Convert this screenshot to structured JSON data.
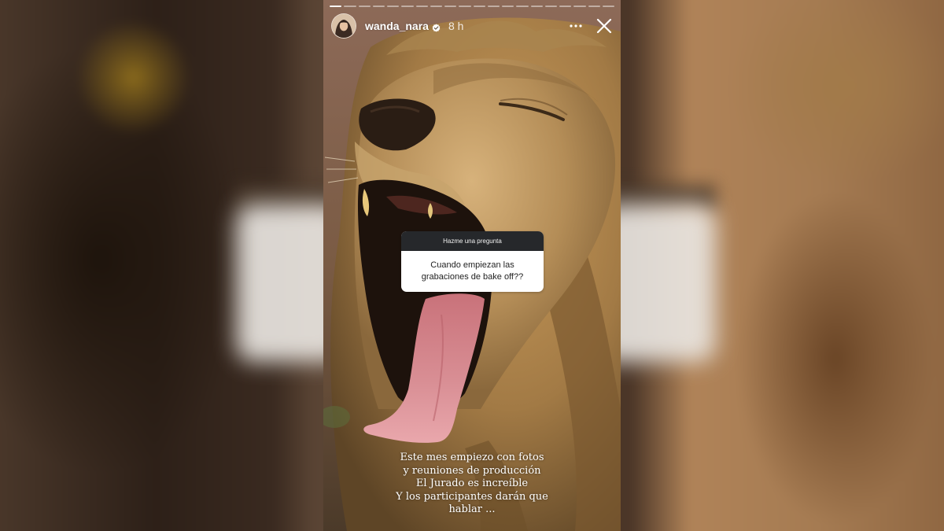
{
  "story": {
    "progress": {
      "segments_total": 20,
      "segments_viewed": 1
    },
    "header": {
      "username": "wanda_nara",
      "verified": true,
      "timestamp": "8 h",
      "more_icon": "more-horizontal-icon",
      "close_icon": "close-icon"
    },
    "question_sticker": {
      "prompt": "Hazme una pregunta",
      "question": "Cuando empiezan las grabaciones de bake off??"
    },
    "caption": {
      "lines": [
        "Este mes empiezo con fotos",
        "y reuniones de producción",
        "El Jurado es increíble",
        "Y los participantes darán que",
        "hablar ..."
      ]
    }
  },
  "colors": {
    "sticker_header": "#26282b",
    "sticker_body": "#ffffff",
    "verified_badge": "#ffffff"
  }
}
